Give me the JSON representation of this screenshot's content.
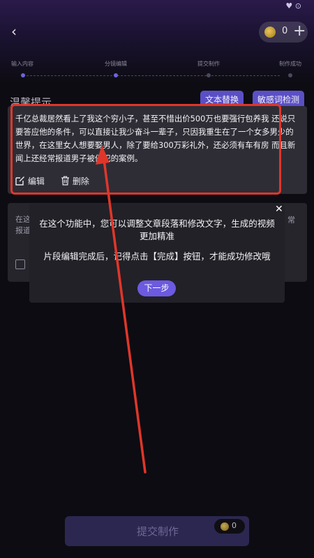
{
  "status": {
    "icons": "♥ ⊙"
  },
  "header": {
    "back_glyph": "‹",
    "coin_count": "0",
    "plus_glyph": "+"
  },
  "steps": [
    "输入内容",
    "分镜编辑",
    "提交制作",
    "制作成功"
  ],
  "tip": {
    "title": "温馨提示"
  },
  "chips": {
    "text_replace": "文本替换",
    "sensitive_check": "敏感词检测"
  },
  "segment": {
    "text": "千亿总裁居然看上了我这个穷小子，甚至不惜出价500万也要强行包养我 还说只要答应他的条件，可以直接让我少奋斗一辈子，只因我重生在了一个女多男少的世界，在这里女人想要娶男人，除了要给300万彩礼外，还必须有车有房 而且新闻上还经常报道男子被侵犯的案例。",
    "edit_label": "编辑",
    "delete_label": "删除"
  },
  "segment2": {
    "line1": "在这",
    "line2": "报道",
    "right": "常"
  },
  "popup": {
    "close_glyph": "✕",
    "line1": "在这个功能中，您可以调整文章段落和修改文字，生成的视频更加精准",
    "line2": "片段编辑完成后，记得点击【完成】按钮，才能成功修改哦",
    "next_label": "下一步"
  },
  "submit": {
    "label": "提交制作",
    "coin_count": "0"
  },
  "colors": {
    "accent": "#6c5ae0",
    "highlight": "#e0362a",
    "card": "#2e2d35",
    "background": "#0d0c12"
  }
}
